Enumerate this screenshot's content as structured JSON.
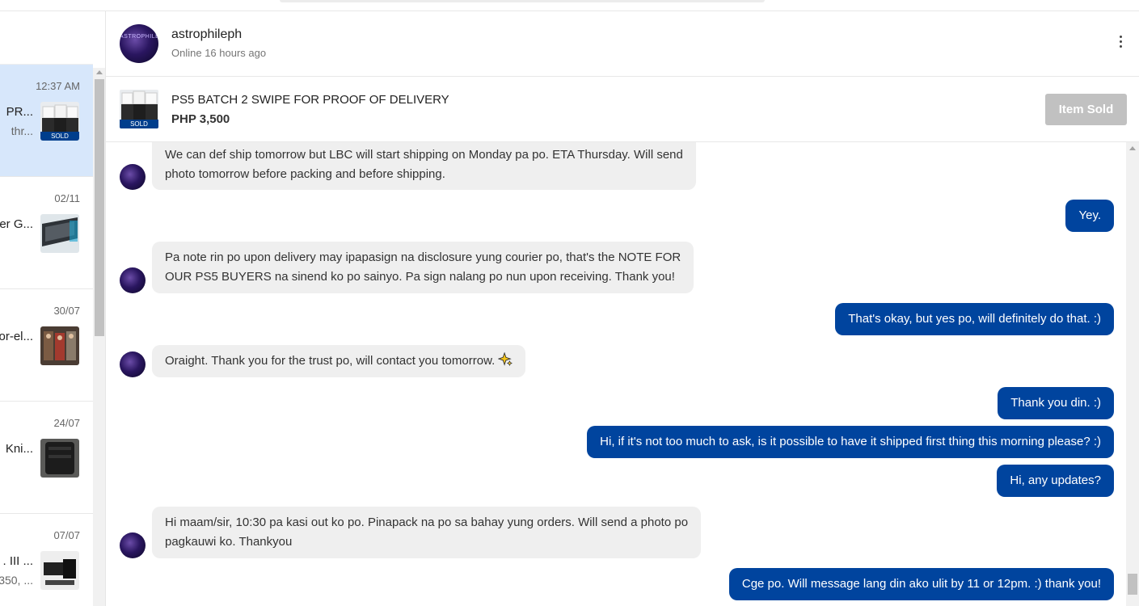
{
  "sidebar": {
    "conversations": [
      {
        "time": "12:37 AM",
        "name": "PR...",
        "snippet": "thr...",
        "tag": "SOLD",
        "active": true
      },
      {
        "time": "02/11",
        "name": "er G...",
        "snippet": "",
        "tag": "",
        "active": false
      },
      {
        "time": "30/07",
        "name": "or-el...",
        "snippet": "",
        "tag": "",
        "active": false
      },
      {
        "time": "24/07",
        "name": "Kni...",
        "snippet": "",
        "tag": "",
        "active": false
      },
      {
        "time": "07/07",
        "name": ". III ...",
        "snippet": "350, ...",
        "tag": "",
        "active": false
      }
    ]
  },
  "header": {
    "username": "astrophileph",
    "status": "Online 16 hours ago",
    "avatar_text": "ASTROPHILE"
  },
  "product": {
    "title": "PS5 BATCH 2 SWIPE FOR PROOF OF DELIVERY",
    "price": "PHP 3,500",
    "tag": "SOLD",
    "button_label": "Item Sold"
  },
  "messages": [
    {
      "dir": "in",
      "lines": [
        "We can def ship tomorrow but LBC will start shipping on Monday pa po. ETA Thursday. Will send",
        "photo tomorrow before packing and before shipping."
      ]
    },
    {
      "dir": "out",
      "lines": [
        "Yey."
      ]
    },
    {
      "dir": "in",
      "lines": [
        "Pa note rin po upon delivery may ipapasign na disclosure yung courier po, that's the NOTE FOR",
        "OUR PS5 BUYERS na sinend ko po sainyo. Pa sign nalang po nun upon receiving. Thank you!"
      ]
    },
    {
      "dir": "out",
      "lines": [
        "That's okay, but yes po, will definitely do that. :)"
      ]
    },
    {
      "dir": "in",
      "lines": [
        "Oraight. Thank you for the trust po, will contact you tomorrow."
      ],
      "emoji": "sparkle-icon"
    },
    {
      "dir": "out",
      "lines": [
        "Thank you din. :)"
      ]
    },
    {
      "dir": "out",
      "lines": [
        "Hi, if it's not too much to ask, is it possible to have it shipped first thing this morning please? :)"
      ]
    },
    {
      "dir": "out",
      "lines": [
        "Hi, any updates?"
      ]
    },
    {
      "dir": "in",
      "lines": [
        "Hi maam/sir, 10:30 pa kasi out ko po. Pinapack na po sa bahay yung orders. Will send a photo po",
        "pagkauwi ko. Thankyou"
      ]
    },
    {
      "dir": "out",
      "lines": [
        "Cge po. Will message lang din ako ulit by 11 or 12pm. :) thank you!"
      ]
    }
  ],
  "colors": {
    "outgoing": "#00449e",
    "incoming": "#efefef",
    "active_conv": "#d7e7fb",
    "sold_tag": "#003e8c",
    "sold_button": "#c1c1c1"
  }
}
